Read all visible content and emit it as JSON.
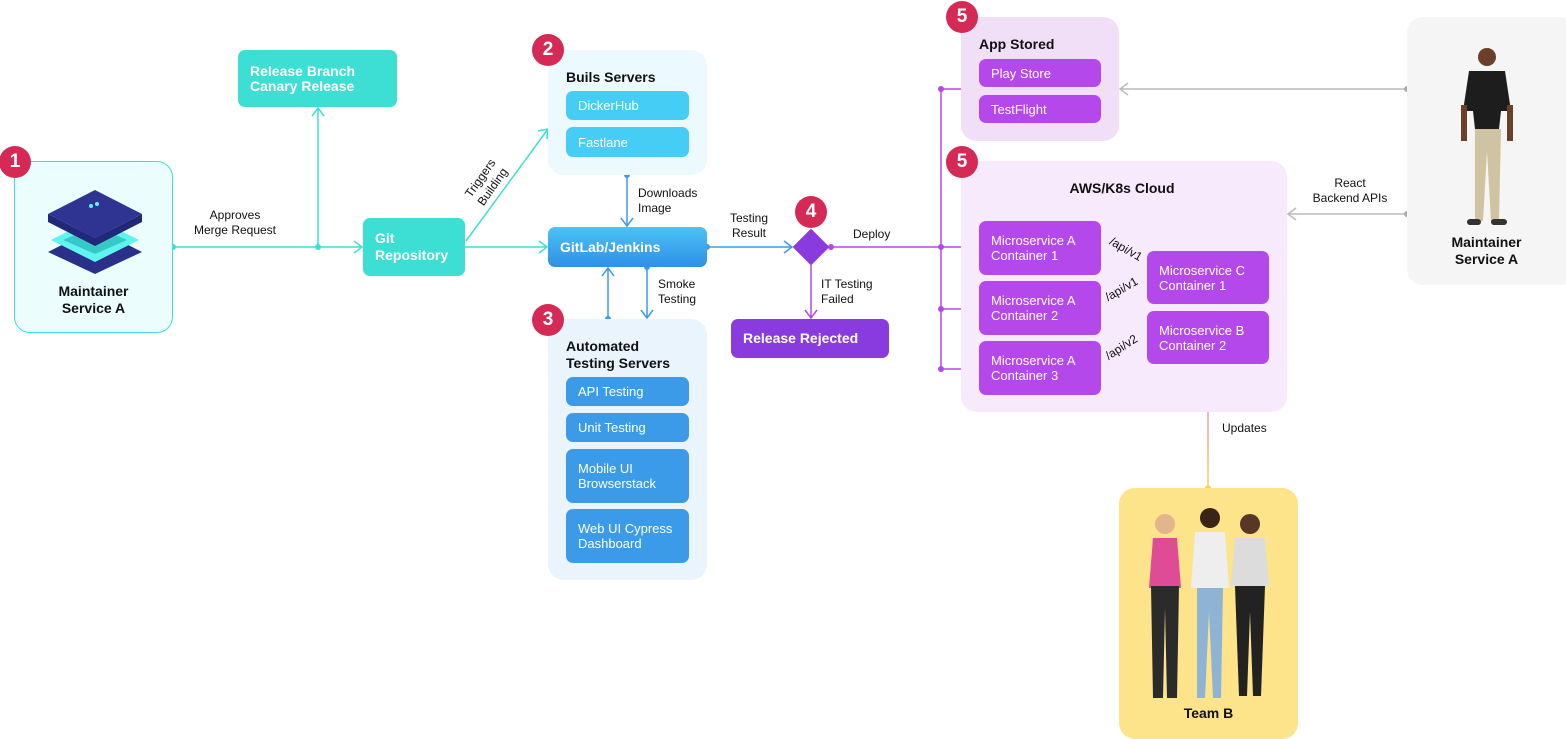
{
  "badges": [
    "1",
    "2",
    "3",
    "4",
    "5",
    "5"
  ],
  "maintainer_left": {
    "label_line1": "Maintainer",
    "label_line2": "Service A"
  },
  "release_branch": {
    "line1": "Release Branch",
    "line2": "Canary Release"
  },
  "git_repo": {
    "line1": "Git",
    "line2": "Repository"
  },
  "build_servers": {
    "title": "Buils Servers",
    "items": [
      "DickerHub",
      "Fastlane"
    ]
  },
  "gitlab": {
    "label": "GitLab/Jenkins"
  },
  "testing_servers": {
    "title_line1": "Automated",
    "title_line2": "Testing Servers",
    "items": [
      {
        "line1": "API Testing",
        "line2": ""
      },
      {
        "line1": "Unit Testing",
        "line2": ""
      },
      {
        "line1": "Mobile UI",
        "line2": "Browserstack"
      },
      {
        "line1": "Web UI Cypress",
        "line2": "Dashboard"
      }
    ]
  },
  "release_rejected": {
    "label": "Release Rejected"
  },
  "app_stored": {
    "title": "App Stored",
    "items": [
      "Play Store",
      "TestFlight"
    ]
  },
  "cloud": {
    "title": "AWS/K8s Cloud",
    "containers": [
      {
        "line1": "Microservice A",
        "line2": "Container 1"
      },
      {
        "line1": "Microservice A",
        "line2": "Container 2"
      },
      {
        "line1": "Microservice A",
        "line2": "Container 3"
      },
      {
        "line1": "Microservice C",
        "line2": "Container 1"
      },
      {
        "line1": "Microservice B",
        "line2": "Container 2"
      }
    ],
    "api_labels": [
      "/api/v1",
      "/api/v1",
      "/api/v2"
    ]
  },
  "maintainer_right": {
    "label_line1": "Maintainer",
    "label_line2": "Service A"
  },
  "team_b": {
    "label": "Team B"
  },
  "edges": {
    "approves": [
      "Approves",
      "Merge Request"
    ],
    "triggers": [
      "Triggers",
      "Building"
    ],
    "downloads": [
      "Downloads",
      "Image"
    ],
    "smoke": [
      "Smoke",
      "Testing"
    ],
    "testing_result": [
      "Testing",
      "Result"
    ],
    "deploy": "Deploy",
    "it_failed": [
      "IT Testing",
      "Failed"
    ],
    "react": [
      "React",
      "Backend APIs"
    ],
    "updates": "Updates"
  },
  "colors": {
    "teal": "#3ddfd4",
    "badge": "#d42a55",
    "sky": "#46cdf5",
    "blue": "#3b9be9",
    "purple": "#b548ea",
    "violet": "#8a3be0"
  }
}
